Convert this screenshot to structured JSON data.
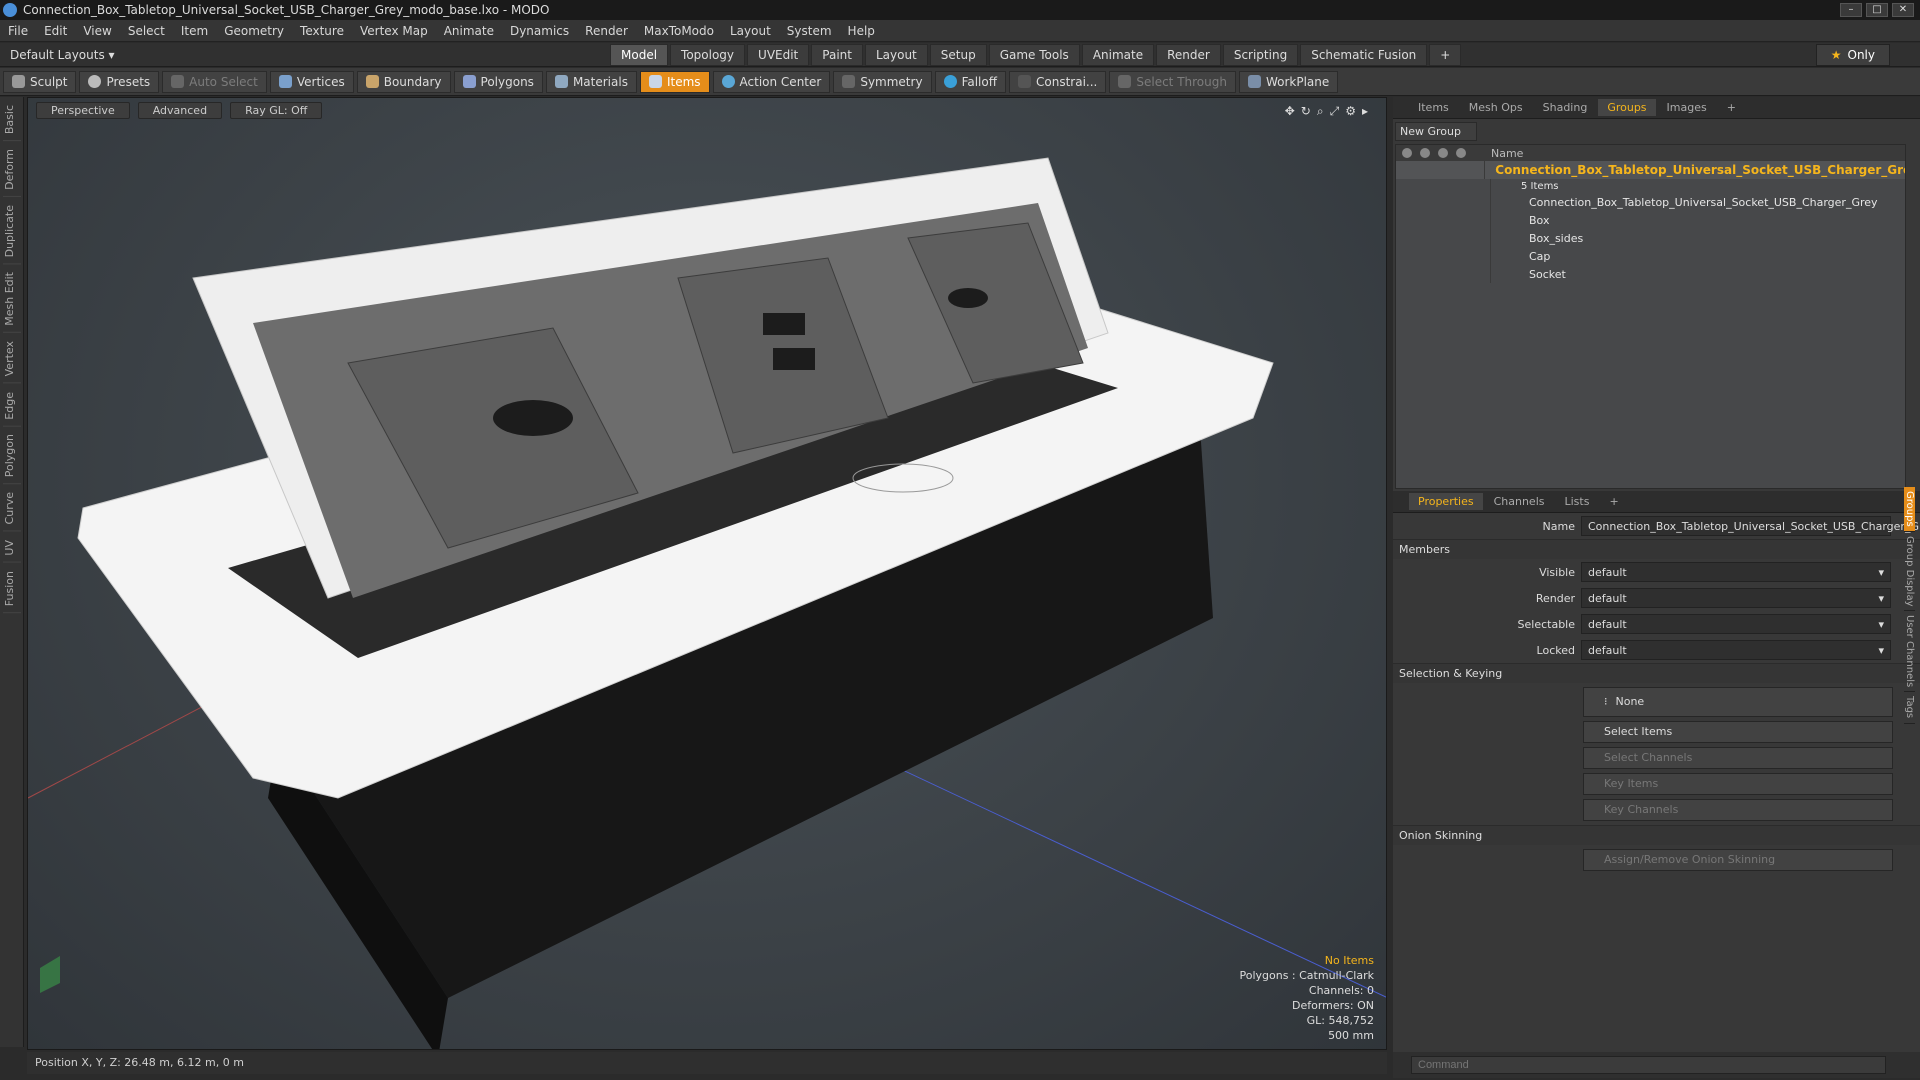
{
  "window": {
    "title": "Connection_Box_Tabletop_Universal_Socket_USB_Charger_Grey_modo_base.lxo - MODO",
    "controls": [
      "–",
      "□",
      "✕"
    ]
  },
  "menu": [
    "File",
    "Edit",
    "View",
    "Select",
    "Item",
    "Geometry",
    "Texture",
    "Vertex Map",
    "Animate",
    "Dynamics",
    "Render",
    "MaxToModo",
    "Layout",
    "System",
    "Help"
  ],
  "layoutbar": {
    "layouts_label": "Default Layouts ▾",
    "tabs": [
      "Model",
      "Topology",
      "UVEdit",
      "Paint",
      "Layout",
      "Setup",
      "Game Tools",
      "Animate",
      "Render",
      "Scripting",
      "Schematic Fusion",
      "+"
    ],
    "active_tab": "Model",
    "only_label": "Only"
  },
  "toolbar": {
    "sculpt": "Sculpt",
    "presets": "Presets",
    "auto_select": "Auto Select",
    "vertices": "Vertices",
    "boundary": "Boundary",
    "polygons": "Polygons",
    "materials": "Materials",
    "items": "Items",
    "action_center": "Action Center",
    "symmetry": "Symmetry",
    "falloff": "Falloff",
    "constraints": "Constrai...",
    "select_through": "Select Through",
    "workplane": "WorkPlane"
  },
  "left_tabs": [
    "Basic",
    "Deform",
    "Duplicate",
    "Mesh Edit",
    "Vertex",
    "Edge",
    "Polygon",
    "Curve",
    "UV",
    "Fusion"
  ],
  "viewport": {
    "view": "Perspective",
    "shading": "Advanced",
    "raygl": "Ray GL: Off",
    "info": {
      "selection": "No Items",
      "polygons": "Polygons : Catmull-Clark",
      "channels": "Channels: 0",
      "deformers": "Deformers: ON",
      "gl": "GL: 548,752",
      "scale": "500 mm"
    }
  },
  "status": {
    "position": "Position X, Y, Z:   26.48 m, 6.12 m, 0 m"
  },
  "groups_panel": {
    "tabs": [
      "Items",
      "Mesh Ops",
      "Shading",
      "Groups",
      "Images",
      "+"
    ],
    "active": "Groups",
    "new_group": "New Group",
    "name_header": "Name",
    "group_name": "Connection_Box_Tabletop_Universal_Socket_USB_Charger_Grey...",
    "count": "5 Items",
    "items": [
      "Connection_Box_Tabletop_Universal_Socket_USB_Charger_Grey",
      "Box",
      "Box_sides",
      "Cap",
      "Socket"
    ]
  },
  "properties": {
    "tabs": [
      "Properties",
      "Channels",
      "Lists",
      "+"
    ],
    "active": "Properties",
    "name_label": "Name",
    "name_value": "Connection_Box_Tabletop_Universal_Socket_USB_Charger_Gi",
    "members_header": "Members",
    "visible_label": "Visible",
    "render_label": "Render",
    "selectable_label": "Selectable",
    "locked_label": "Locked",
    "default_value": "default",
    "selection_header": "Selection & Keying",
    "none_label": "None",
    "select_items": "Select Items",
    "select_channels": "Select Channels",
    "key_items": "Key Items",
    "key_channels": "Key Channels",
    "onion_header": "Onion Skinning",
    "onion_button": "Assign/Remove Onion Skinning"
  },
  "side_tabs": [
    "Groups",
    "Group Display",
    "User Channels",
    "Tags"
  ],
  "command": {
    "placeholder": "Command"
  }
}
